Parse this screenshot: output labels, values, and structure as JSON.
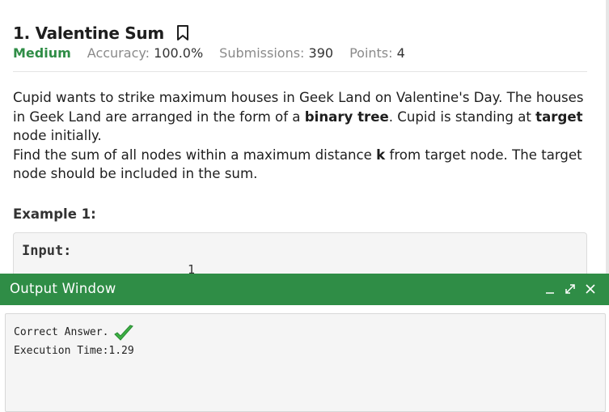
{
  "problem": {
    "title": "1. Valentine Sum",
    "difficulty": "Medium",
    "accuracy_label": "Accuracy:",
    "accuracy_value": "100.0%",
    "submissions_label": "Submissions:",
    "submissions_value": "390",
    "points_label": "Points:",
    "points_value": "4",
    "description": {
      "p1_part1": "Cupid wants to strike maximum houses in Geek Land on Valentine's Day. The houses in Geek Land are arranged in the form of a ",
      "p1_bold1": "binary tree",
      "p1_part2": ". Cupid is standing at ",
      "p1_bold2": "target",
      "p1_part3": " node initially.",
      "p2_part1": "Find the sum of all nodes within a maximum distance ",
      "p2_bold": "k",
      "p2_part2": " from target node. The target node should be included in the sum."
    },
    "example_title": "Example 1:",
    "example_input_label": "Input:",
    "example_tree_root": "1"
  },
  "output_window": {
    "title": "Output Window",
    "result_text": "Correct Answer.",
    "execution_time": "Execution Time:1.29"
  },
  "colors": {
    "brand_green": "#2f8d46",
    "check_green": "#3cb043"
  }
}
